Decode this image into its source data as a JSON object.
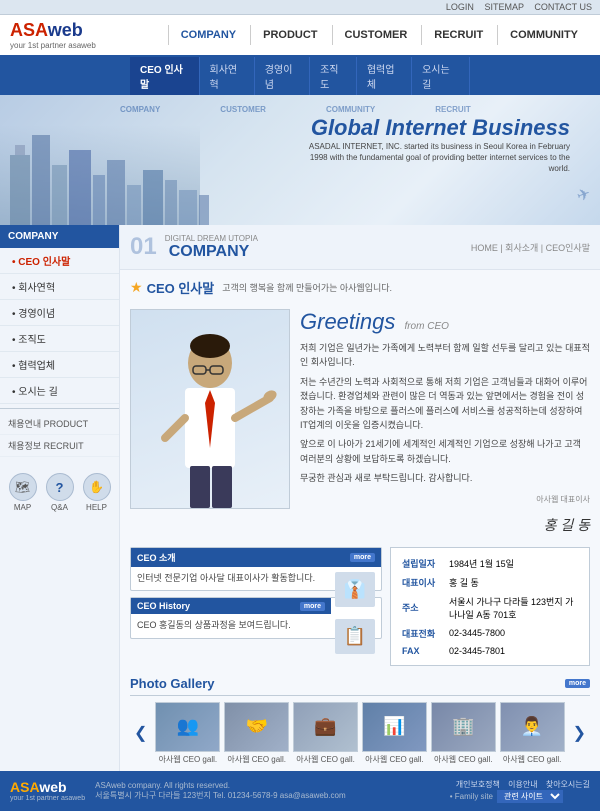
{
  "topbar": {
    "links": [
      "LOGIN",
      "SITEMAP",
      "CONTACT US"
    ]
  },
  "header": {
    "logo_main": "ASAweb",
    "logo_sub": "your 1st partner asaweb",
    "nav_items": [
      {
        "label": "COMPANY",
        "active": true
      },
      {
        "label": "PRODUCT",
        "active": false
      },
      {
        "label": "CUSTOMER",
        "active": false
      },
      {
        "label": "RECRUIT",
        "active": false
      },
      {
        "label": "COMMUNITY",
        "active": false
      }
    ]
  },
  "subnav": {
    "items": [
      {
        "label": "CEO 인사말",
        "active": true
      },
      {
        "label": "회사연혁",
        "active": false
      },
      {
        "label": "경영이념",
        "active": false
      },
      {
        "label": "조직도",
        "active": false
      },
      {
        "label": "협력업체",
        "active": false
      },
      {
        "label": "오시는 길",
        "active": false
      }
    ]
  },
  "hero": {
    "title": "Global Internet Business",
    "description": "ASADAL INTERNET, INC. started its business in Seoul Korea in February 1998 with the fundamental goal of providing better internet services to the world.",
    "tags": [
      "COMPANY",
      "CUSTOMER",
      "COMMUNITY",
      "RECRUIT"
    ]
  },
  "sidebar": {
    "section_title": "• CEO 인사말",
    "menu_items": [
      {
        "label": "• CEO 인사말",
        "active": true
      },
      {
        "label": "• 회사연혁",
        "active": false
      },
      {
        "label": "• 경영이념",
        "active": false
      },
      {
        "label": "• 조직도",
        "active": false
      },
      {
        "label": "• 협력업체",
        "active": false
      },
      {
        "label": "• 오시는 길",
        "active": false
      }
    ],
    "sub_sections": [
      {
        "label": "채용연내 PRODUCT"
      },
      {
        "label": "채용정보 RECRUIT"
      }
    ],
    "icons": [
      {
        "label": "MAP",
        "icon": "🗺"
      },
      {
        "label": "Q&A",
        "icon": "?"
      },
      {
        "label": "HELP",
        "icon": "✋"
      }
    ]
  },
  "page": {
    "number": "01",
    "label": "DIGITAL DREAM UTOPIA",
    "title": "COMPANY",
    "breadcrumb": "HOME  |  회사소개  |  CEO인사말",
    "section_bullet": "★",
    "section_title": "CEO 인사말",
    "section_sub": "고객의 행복을 함께 만들어가는 아사웹입니다."
  },
  "greeting": {
    "title": "Greetings",
    "from": "from CEO",
    "paragraphs": [
      "저희 기업은 일년가는 가족에게 노력부터 함께 일할 선두를 달리고 있는 대표적인 회사입니다.",
      "저는 수년간의 노력과 사회적으로 통해 저희 기업은 고객님들과 대화어 이루어졌습니다. 환경업체와 관련이 많은 더 역동과 있는 앞면에서는 경험을 전이 성장하는 가족을 바탕으로 플러스에 플러스에 서비스를 성공적하는데 성장하여 IT업계의 이웃을 입증시켰습니다.",
      "앞으로 이 나아가 21세기에 세계적인 세계적인 기업으로 성장해 나가고 고객 여러분의 상황에 보답하도록 하겠습니다.",
      "무궁한 관심과 새로 부탁드립니다. 감사합니다."
    ],
    "signature": "홍 길 동",
    "signature_sub": "아사웹 대표이사"
  },
  "ceo_info": {
    "profile": {
      "title": "CEO 소개",
      "more": "more",
      "desc1": "인터넷 전문기업 아사달 대표이사가 활동합니다.",
      "desc2": ""
    },
    "history": {
      "title": "CEO History",
      "more": "more",
      "desc1": "CEO 홍길동의 상품과정을 보여드립니다."
    }
  },
  "company_details": {
    "items": [
      {
        "label": "설립일자",
        "value": "1984년 1월 15일"
      },
      {
        "label": "대표이사",
        "value": "홍 길 동"
      },
      {
        "label": "주소",
        "value": "서울시 가나구 다라들 123번지 가나나일 A동 701호"
      },
      {
        "label": "대표전화",
        "value": "02-3445-7800"
      },
      {
        "label": "FAX",
        "value": "02-3445-7801"
      }
    ]
  },
  "gallery": {
    "title": "Photo Gallery",
    "more": "more",
    "items": [
      {
        "caption": "아사웹 CEO gall."
      },
      {
        "caption": "아사웹 CEO gall."
      },
      {
        "caption": "아사웹 CEO gall."
      },
      {
        "caption": "아사웹 CEO gall."
      },
      {
        "caption": "아사웹 CEO gall."
      },
      {
        "caption": "아사웹 CEO gall."
      }
    ]
  },
  "footer": {
    "logo": "ASAweb",
    "logo_sub": "your 1st partner asaweb",
    "copyright": "ASAweb company. All rights reserved.",
    "address": "서울특별시 가나구 다라들 123번지 Tel. 01234-5678-9 asa@asaweb.com",
    "links": [
      "개인보호정책",
      "이용안내",
      "찾아오시는길"
    ],
    "family_label": "• Family site",
    "family_option": "관련 사이트"
  }
}
